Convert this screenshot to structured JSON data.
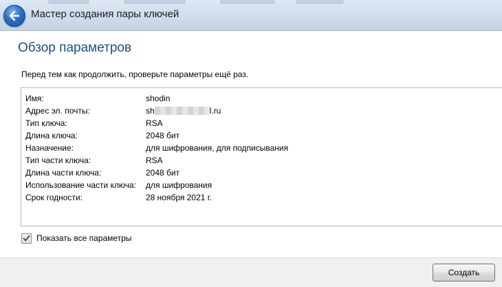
{
  "window": {
    "title": "Мастер создания пары ключей"
  },
  "page": {
    "heading": "Обзор параметров",
    "intro": "Перед тем как продолжить, проверьте параметры ещё раз."
  },
  "params": [
    {
      "label": "Имя:",
      "value": "shodin"
    },
    {
      "label": "Адрес эл. почты:",
      "value_prefix": "sh",
      "value_suffix": "l.ru"
    },
    {
      "label": "Тип ключа:",
      "value": "RSA"
    },
    {
      "label": "Длина ключа:",
      "value": "2048 бит"
    },
    {
      "label": "Назначение:",
      "value": "для шифрования, для подписывания"
    },
    {
      "label": "Тип части ключа:",
      "value": "RSA"
    },
    {
      "label": "Длина части ключа:",
      "value": "2048 бит"
    },
    {
      "label": "Использование части ключа:",
      "value": "для шифрования"
    },
    {
      "label": "Срок годности:",
      "value": "28 ноября 2021 г."
    }
  ],
  "show_all": {
    "label": "Показать все параметры",
    "checked": true
  },
  "footer": {
    "create_label": "Создать"
  }
}
